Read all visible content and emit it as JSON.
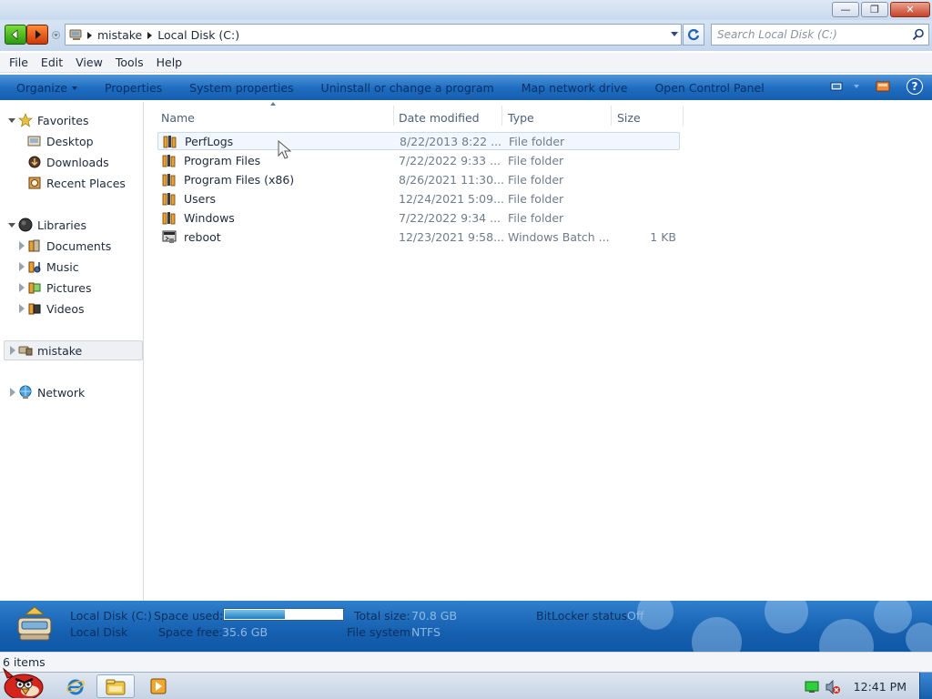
{
  "window": {
    "minimize_glyph": "—",
    "restore_glyph": "❐",
    "close_glyph": "✕"
  },
  "address": {
    "crumbs": [
      "mistake",
      "Local Disk (C:)"
    ],
    "search_placeholder": "Search Local Disk (C:)"
  },
  "menu": [
    "File",
    "Edit",
    "View",
    "Tools",
    "Help"
  ],
  "commands": {
    "organize": "Organize",
    "properties": "Properties",
    "system_properties": "System properties",
    "uninstall": "Uninstall or change a program",
    "map_drive": "Map network drive",
    "control_panel": "Open Control Panel",
    "help": "?"
  },
  "nav": {
    "favorites": "Favorites",
    "desktop": "Desktop",
    "downloads": "Downloads",
    "recent_places": "Recent Places",
    "libraries": "Libraries",
    "documents": "Documents",
    "music": "Music",
    "pictures": "Pictures",
    "videos": "Videos",
    "computer": "mistake",
    "network": "Network"
  },
  "columns": {
    "name": "Name",
    "date": "Date modified",
    "type": "Type",
    "size": "Size"
  },
  "files": [
    {
      "name": "PerfLogs",
      "date": "8/22/2013 8:22 ...",
      "type": "File folder",
      "size": ""
    },
    {
      "name": "Program Files",
      "date": "7/22/2022 9:33 ...",
      "type": "File folder",
      "size": ""
    },
    {
      "name": "Program Files (x86)",
      "date": "8/26/2021 11:30...",
      "type": "File folder",
      "size": ""
    },
    {
      "name": "Users",
      "date": "12/24/2021 5:09...",
      "type": "File folder",
      "size": ""
    },
    {
      "name": "Windows",
      "date": "7/22/2022 9:34 ...",
      "type": "File folder",
      "size": ""
    },
    {
      "name": "reboot",
      "date": "12/23/2021 9:58...",
      "type": "Windows Batch ...",
      "size": "1 KB"
    }
  ],
  "details": {
    "drive_name": "Local Disk (C:)",
    "drive_type": "Local Disk",
    "space_used_label": "Space used:",
    "space_used_fraction": 0.5,
    "space_free_label": "Space free:",
    "space_free_value": "35.6 GB",
    "total_size_label": "Total size:",
    "total_size_value": "70.8 GB",
    "file_system_label": "File system:",
    "file_system_value": "NTFS",
    "bitlocker_label": "BitLocker status:",
    "bitlocker_value": "Off"
  },
  "status": {
    "items": "6 items"
  },
  "taskbar": {
    "clock": "12:41 PM"
  }
}
